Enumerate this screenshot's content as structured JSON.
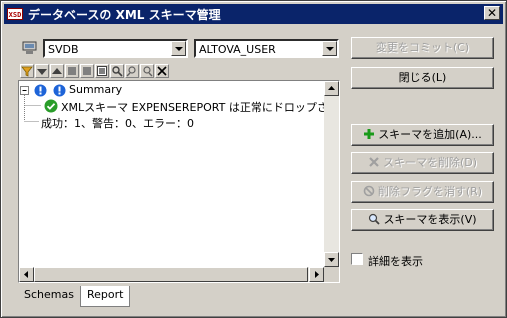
{
  "window": {
    "title": "データベースの XML スキーマ管理",
    "app_icon_text": "XSD",
    "close_symbol": "✕"
  },
  "connection": {
    "database": "SVDB",
    "schema_user": "ALTOVA_USER"
  },
  "toolbar": {
    "icons": [
      "filter-icon",
      "move-down-icon",
      "move-up-icon",
      "square-icon",
      "square-icon",
      "view-icon",
      "search-icon",
      "find-prev-icon",
      "find-next-icon",
      "clear-icon"
    ]
  },
  "report": {
    "summary_label": "Summary",
    "message": "XMLスキーマ EXPENSEREPORT は正常にドロップされました",
    "result": "成功：1、警告：0、エラー：0"
  },
  "tabs": [
    {
      "label": "Schemas",
      "active": false
    },
    {
      "label": "Report",
      "active": true
    }
  ],
  "buttons": {
    "commit": "変更をコミット(C)",
    "close": "閉じる(L)",
    "add": "スキーマを追加(A)...",
    "delete": "スキーマを削除(D)",
    "remove_flag": "削除フラグを消す(R)",
    "show": "スキーマを表示(V)"
  },
  "details_checkbox": {
    "label": "詳細を表示",
    "checked": false
  },
  "colors": {
    "titlebar": "#0a246a",
    "face": "#d4d0c8",
    "success": "#2a9d2a",
    "info": "#1e64d8",
    "add_icon": "#1a9a1a"
  }
}
